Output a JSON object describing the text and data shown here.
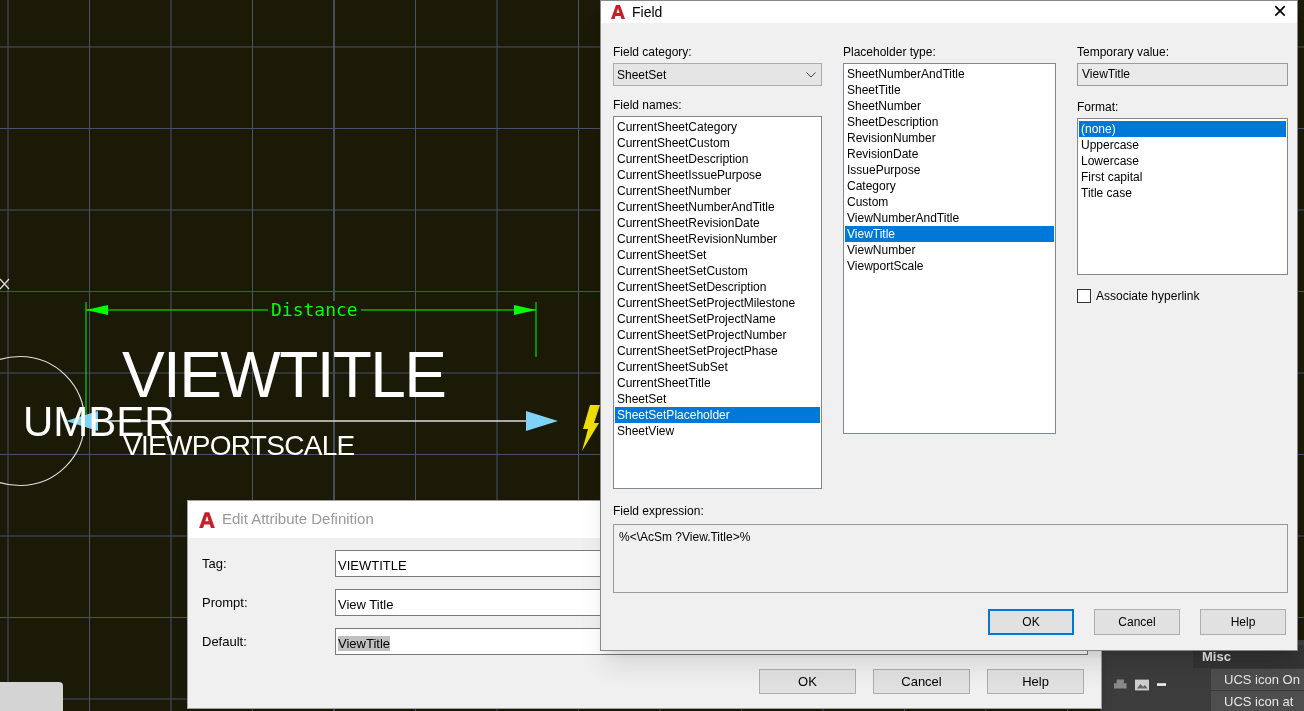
{
  "canvas": {
    "texts": [
      {
        "kind": "title",
        "text": "VIEWTITLE"
      },
      {
        "kind": "number",
        "text": "UMBER"
      },
      {
        "kind": "scale",
        "text": "VIEWPORTSCALE"
      },
      {
        "kind": "dimension",
        "text": "Distance"
      }
    ]
  },
  "edit_attribute_dialog": {
    "title": "Edit Attribute Definition",
    "fields": [
      {
        "label": "Tag:",
        "value": "VIEWTITLE",
        "value_selected": false
      },
      {
        "label": "Prompt:",
        "value": "View Title",
        "value_selected": false
      },
      {
        "label": "Default:",
        "value": "ViewTitle",
        "value_selected": true
      }
    ],
    "buttons": [
      "OK",
      "Cancel",
      "Help"
    ]
  },
  "field_dialog": {
    "title": "Field",
    "close": "×",
    "field_category": {
      "label": "Field category:",
      "value": "SheetSet"
    },
    "field_names": {
      "label": "Field names:",
      "items": [
        {
          "label": "CurrentSheetCategory",
          "selected": false
        },
        {
          "label": "CurrentSheetCustom",
          "selected": false
        },
        {
          "label": "CurrentSheetDescription",
          "selected": false
        },
        {
          "label": "CurrentSheetIssuePurpose",
          "selected": false
        },
        {
          "label": "CurrentSheetNumber",
          "selected": false
        },
        {
          "label": "CurrentSheetNumberAndTitle",
          "selected": false
        },
        {
          "label": "CurrentSheetRevisionDate",
          "selected": false
        },
        {
          "label": "CurrentSheetRevisionNumber",
          "selected": false
        },
        {
          "label": "CurrentSheetSet",
          "selected": false
        },
        {
          "label": "CurrentSheetSetCustom",
          "selected": false
        },
        {
          "label": "CurrentSheetSetDescription",
          "selected": false
        },
        {
          "label": "CurrentSheetSetProjectMilestone",
          "selected": false
        },
        {
          "label": "CurrentSheetSetProjectName",
          "selected": false
        },
        {
          "label": "CurrentSheetSetProjectNumber",
          "selected": false
        },
        {
          "label": "CurrentSheetSetProjectPhase",
          "selected": false
        },
        {
          "label": "CurrentSheetSubSet",
          "selected": false
        },
        {
          "label": "CurrentSheetTitle",
          "selected": false
        },
        {
          "label": "SheetSet",
          "selected": false
        },
        {
          "label": "SheetSetPlaceholder",
          "selected": true
        },
        {
          "label": "SheetView",
          "selected": false
        }
      ]
    },
    "placeholder_type": {
      "label": "Placeholder type:",
      "items": [
        {
          "label": "SheetNumberAndTitle",
          "selected": false
        },
        {
          "label": "SheetTitle",
          "selected": false
        },
        {
          "label": "SheetNumber",
          "selected": false
        },
        {
          "label": "SheetDescription",
          "selected": false
        },
        {
          "label": "RevisionNumber",
          "selected": false
        },
        {
          "label": "RevisionDate",
          "selected": false
        },
        {
          "label": "IssuePurpose",
          "selected": false
        },
        {
          "label": "Category",
          "selected": false
        },
        {
          "label": "Custom",
          "selected": false
        },
        {
          "label": "ViewNumberAndTitle",
          "selected": false
        },
        {
          "label": "ViewTitle",
          "selected": true
        },
        {
          "label": "ViewNumber",
          "selected": false
        },
        {
          "label": "ViewportScale",
          "selected": false
        }
      ]
    },
    "temporary_value": {
      "label": "Temporary value:",
      "value": "ViewTitle"
    },
    "format": {
      "label": "Format:",
      "items": [
        {
          "label": "(none)",
          "selected": true
        },
        {
          "label": "Uppercase",
          "selected": false
        },
        {
          "label": "Lowercase",
          "selected": false
        },
        {
          "label": "First capital",
          "selected": false
        },
        {
          "label": "Title case",
          "selected": false
        }
      ]
    },
    "associate_hyperlink": {
      "label": "Associate hyperlink",
      "checked": false
    },
    "field_expression": {
      "label": "Field expression:",
      "value": "%<\\AcSm ?View.Title>%"
    },
    "buttons": [
      {
        "label": "OK",
        "default": true
      },
      {
        "label": "Cancel",
        "default": false
      },
      {
        "label": "Help",
        "default": false
      }
    ]
  },
  "properties_panel": {
    "section": "Misc",
    "rows": [
      "UCS icon On",
      "UCS icon at"
    ]
  }
}
